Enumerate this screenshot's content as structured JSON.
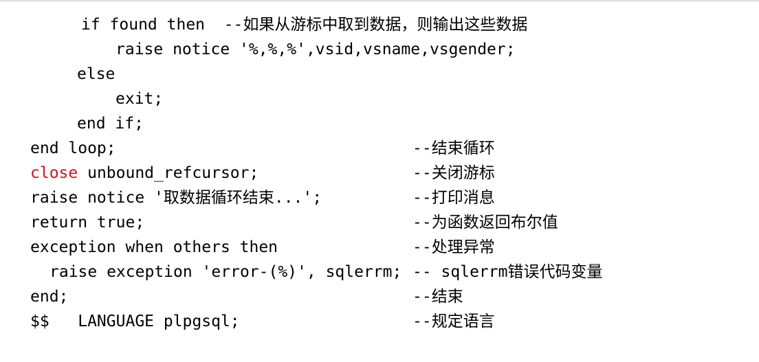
{
  "code_lines": [
    {
      "text": "if found then  --如果从游标中取到数据，则输出这些数据"
    },
    {
      "text": "raise notice '%,%,%',vsid,vsname,vsgender;"
    },
    {
      "text": "else"
    },
    {
      "text": "exit;"
    },
    {
      "text": "end if;"
    },
    {
      "text": "end loop;",
      "comment": "--结束循环"
    },
    {
      "keyword": "close",
      "rest": " unbound_refcursor;",
      "comment": "--关闭游标"
    },
    {
      "text": "raise notice '取数据循环结束...';",
      "comment": "--打印消息"
    },
    {
      "text": "return true;",
      "comment": "--为函数返回布尔值"
    },
    {
      "text": "exception when others then",
      "comment": "--处理异常"
    },
    {
      "text": "raise exception 'error-(%)', sqlerrm;",
      "comment": "-- sqlerrm错误代码变量"
    },
    {
      "text": "end;",
      "comment": "--结束"
    },
    {
      "text": "$$   LANGUAGE plpgsql;",
      "comment": "--规定语言"
    }
  ],
  "colors": {
    "keyword_close": "#d0121b",
    "text": "#000000"
  }
}
